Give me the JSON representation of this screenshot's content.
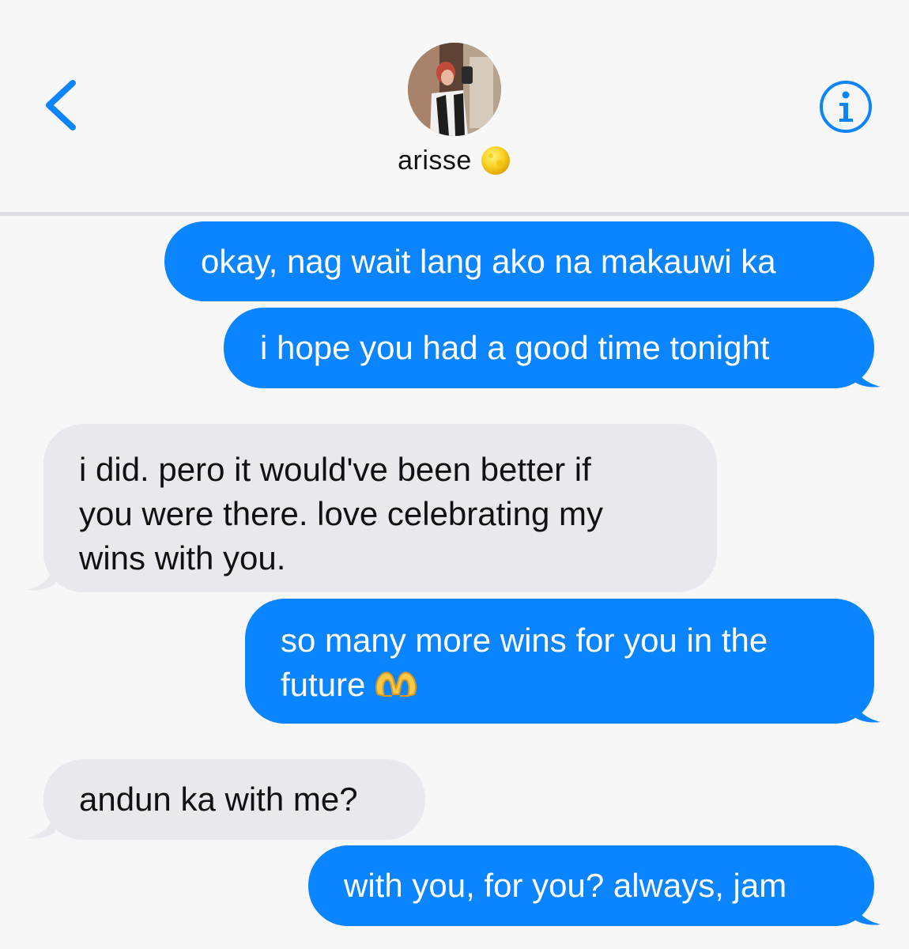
{
  "header": {
    "contact_name": "arisse",
    "status_icon": "yellow-circle-emoji",
    "back_icon": "chevron-left-icon",
    "info_icon": "info-icon",
    "accent_color": "#0a84ff"
  },
  "messages": [
    {
      "direction": "sent",
      "text": "okay, nag wait lang ako na makauwi ka"
    },
    {
      "direction": "sent",
      "text": "i hope you had a good time tonight"
    },
    {
      "direction": "received",
      "lines": [
        "i did. pero it would've been better if",
        "you were there. love celebrating my",
        "wins with you."
      ]
    },
    {
      "direction": "sent",
      "lines": [
        "so many more wins for you in the",
        "future"
      ],
      "emoji": "heart-hands-emoji"
    },
    {
      "direction": "received",
      "text": "andun ka with me?"
    },
    {
      "direction": "sent",
      "text": "with you, for you? always, jam"
    }
  ]
}
